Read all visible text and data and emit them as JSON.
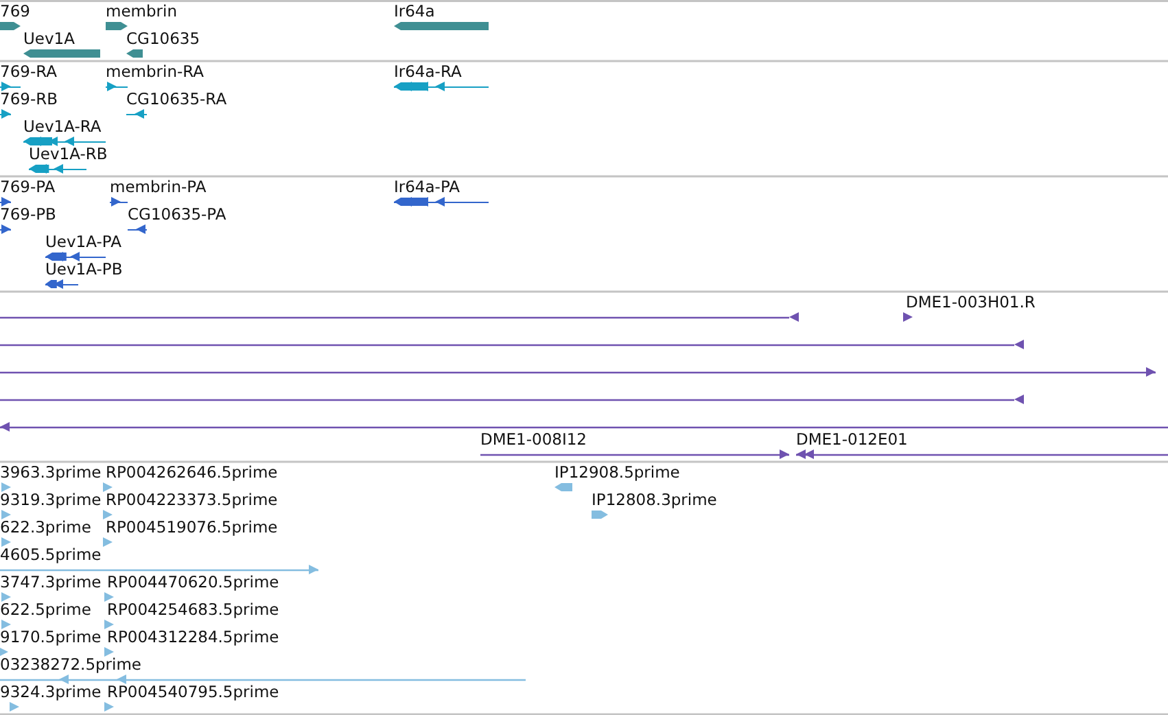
{
  "tracks": [
    {
      "color": "#3f8f93",
      "features": [
        {
          "label": "769",
          "reverse": false
        },
        {
          "label": "membrin",
          "reverse": false
        },
        {
          "label": "Ir64a",
          "reverse": true
        },
        {
          "label": "Uev1A",
          "reverse": true
        },
        {
          "label": "CG10635",
          "reverse": true
        }
      ]
    },
    {
      "color": "#17a0c4",
      "features": [
        {
          "label": "769-RA",
          "reverse": false
        },
        {
          "label": "membrin-RA",
          "reverse": false
        },
        {
          "label": "Ir64a-RA",
          "reverse": true
        },
        {
          "label": "769-RB",
          "reverse": false
        },
        {
          "label": "CG10635-RA",
          "reverse": true
        },
        {
          "label": "Uev1A-RA",
          "reverse": true
        },
        {
          "label": "Uev1A-RB",
          "reverse": true
        }
      ]
    },
    {
      "color": "#3366cc",
      "features": [
        {
          "label": "769-PA",
          "reverse": false
        },
        {
          "label": "membrin-PA",
          "reverse": false
        },
        {
          "label": "Ir64a-PA",
          "reverse": true
        },
        {
          "label": "769-PB",
          "reverse": false
        },
        {
          "label": "CG10635-PA",
          "reverse": true
        },
        {
          "label": "Uev1A-PA",
          "reverse": true
        },
        {
          "label": "Uev1A-PB",
          "reverse": true
        }
      ]
    },
    {
      "color": "#6f52b0",
      "features": [
        {
          "reverse": true
        },
        {
          "label": "DME1-003H01.R",
          "reverse": false
        },
        {
          "reverse": true
        },
        {
          "reverse": false
        },
        {
          "reverse": true
        },
        {
          "reverse": true
        },
        {
          "label": "DME1-008I12",
          "reverse": false
        },
        {
          "label": "DME1-012E01",
          "reverse": true
        }
      ]
    },
    {
      "color": "#84bde0",
      "features": [
        {
          "label": "3963.3prime",
          "reverse": false
        },
        {
          "label": "RP004262646.5prime",
          "reverse": false
        },
        {
          "label": "IP12908.5prime",
          "reverse": true
        },
        {
          "label": "9319.3prime",
          "reverse": false
        },
        {
          "label": "RP004223373.5prime",
          "reverse": false
        },
        {
          "label": "IP12808.3prime",
          "reverse": false
        },
        {
          "label": "622.3prime",
          "reverse": false
        },
        {
          "label": "RP004519076.5prime",
          "reverse": false
        },
        {
          "label": "4605.5prime",
          "reverse": false
        },
        {
          "label": "3747.3prime",
          "reverse": false
        },
        {
          "label": "RP004470620.5prime",
          "reverse": false
        },
        {
          "label": "622.5prime",
          "reverse": false
        },
        {
          "label": "RP004254683.5prime",
          "reverse": false
        },
        {
          "label": "9170.5prime",
          "reverse": false
        },
        {
          "label": "RP004312284.5prime",
          "reverse": false
        },
        {
          "label": "03238272.5prime",
          "reverse": true
        },
        {
          "label": "9324.3prime",
          "reverse": false
        },
        {
          "label": "RP004540795.5prime",
          "reverse": false
        }
      ]
    }
  ]
}
